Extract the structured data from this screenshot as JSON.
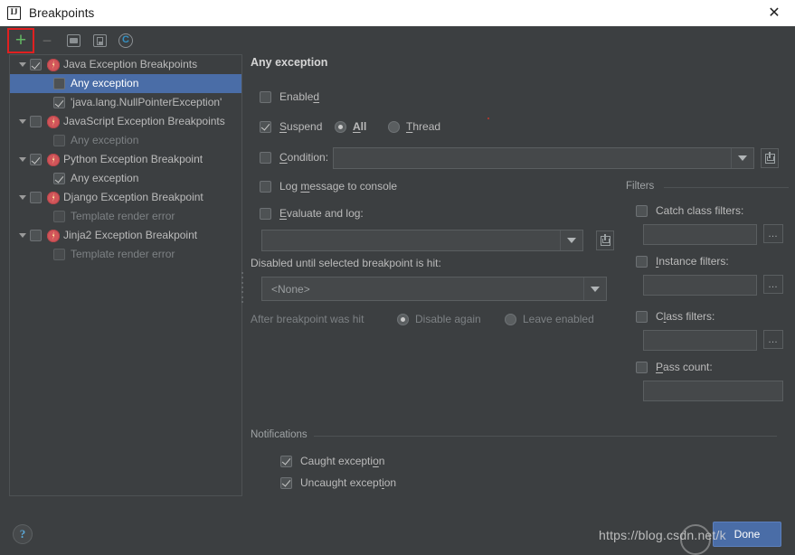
{
  "window": {
    "title": "Breakpoints",
    "logo_icon": "intellij-idea-logo",
    "close_icon": "close-icon"
  },
  "toolbar": {
    "add_label": "+",
    "remove_label": "−",
    "items": [
      {
        "name": "add-breakpoint-button",
        "icon": "plus-icon",
        "label": "+"
      },
      {
        "name": "remove-breakpoint-button",
        "icon": "minus-icon",
        "label": "−"
      },
      {
        "name": "group-by-file-button",
        "icon": "folder-icon",
        "label": ""
      },
      {
        "name": "group-by-type-button",
        "icon": "document-icon",
        "label": ""
      },
      {
        "name": "group-by-class-button",
        "icon": "class-c-icon",
        "label": ""
      }
    ]
  },
  "tree": {
    "selected": "Any exception",
    "nodes": [
      {
        "level": 0,
        "twisty": true,
        "checkbox": "checked",
        "exception_icon": true,
        "label": "Java Exception Breakpoints",
        "dim": false,
        "selected": false
      },
      {
        "level": 1,
        "twisty": false,
        "checkbox": "unchecked",
        "exception_icon": false,
        "label": "Any exception",
        "dim": false,
        "selected": true
      },
      {
        "level": 1,
        "twisty": false,
        "checkbox": "checked",
        "exception_icon": false,
        "label": "'java.lang.NullPointerException'",
        "dim": false,
        "selected": false
      },
      {
        "level": 0,
        "twisty": true,
        "checkbox": "unchecked",
        "exception_icon": true,
        "label": "JavaScript Exception Breakpoints",
        "dim": false,
        "selected": false
      },
      {
        "level": 1,
        "twisty": false,
        "checkbox": "unchecked",
        "exception_icon": false,
        "label": "Any exception",
        "dim": true,
        "selected": false
      },
      {
        "level": 0,
        "twisty": true,
        "checkbox": "checked",
        "exception_icon": true,
        "label": "Python Exception Breakpoint",
        "dim": false,
        "selected": false
      },
      {
        "level": 1,
        "twisty": false,
        "checkbox": "checked",
        "exception_icon": false,
        "label": "Any exception",
        "dim": false,
        "selected": false
      },
      {
        "level": 0,
        "twisty": true,
        "checkbox": "unchecked",
        "exception_icon": true,
        "label": "Django Exception Breakpoint",
        "dim": false,
        "selected": false
      },
      {
        "level": 1,
        "twisty": false,
        "checkbox": "unchecked",
        "exception_icon": false,
        "label": "Template render error",
        "dim": true,
        "selected": false
      },
      {
        "level": 0,
        "twisty": true,
        "checkbox": "unchecked",
        "exception_icon": true,
        "label": "Jinja2 Exception Breakpoint",
        "dim": false,
        "selected": false
      },
      {
        "level": 1,
        "twisty": false,
        "checkbox": "unchecked",
        "exception_icon": false,
        "label": "Template render error",
        "dim": true,
        "selected": false
      }
    ]
  },
  "details": {
    "title": "Any exception",
    "enabled": {
      "label": "Enabled",
      "checked": false
    },
    "suspend": {
      "label": "Suspend",
      "checked": true
    },
    "suspend_all": {
      "label": "All",
      "selected": true
    },
    "suspend_thread": {
      "label": "Thread",
      "selected": false
    },
    "condition": {
      "label": "Condition:",
      "checked": false,
      "value": "",
      "dropdown_icon": "chevron-down-icon",
      "expand_icon": "expand-editor-icon"
    },
    "log_message": {
      "label": "Log message to console",
      "checked": false
    },
    "evaluate_and_log": {
      "label": "Evaluate and log:",
      "checked": false,
      "value": "",
      "dropdown_icon": "chevron-down-icon",
      "expand_icon": "expand-editor-icon"
    },
    "disabled_until": {
      "label": "Disabled until selected breakpoint is hit:",
      "value": "<None>",
      "dropdown_icon": "chevron-down-icon"
    },
    "after_hit": {
      "label": "After breakpoint was hit",
      "disable_again": {
        "label": "Disable again",
        "selected": true
      },
      "leave_enabled": {
        "label": "Leave enabled",
        "selected": false
      }
    }
  },
  "filters": {
    "group_title": "Filters",
    "catch_class": {
      "label": "Catch class filters:",
      "checked": false,
      "value": "",
      "button_label": "…"
    },
    "instance": {
      "label": "Instance filters:",
      "checked": false,
      "value": "",
      "button_label": "…"
    },
    "class": {
      "label": "Class filters:",
      "checked": false,
      "value": "",
      "button_label": "…"
    },
    "pass_count": {
      "label": "Pass count:",
      "checked": false,
      "value": ""
    }
  },
  "notifications": {
    "group_title": "Notifications",
    "caught": {
      "label": "Caught exception",
      "checked": true
    },
    "uncaught": {
      "label": "Uncaught exception",
      "checked": true
    }
  },
  "footer": {
    "help_label": "?",
    "done_label": "Done",
    "watermark": "https://blog.csdn.net/k"
  },
  "colors": {
    "accent": "#4a6da7",
    "add_green": "#62b562",
    "highlight_box": "#e02020",
    "exception_red": "#d1555a",
    "class_icon_blue": "#3592c4"
  }
}
